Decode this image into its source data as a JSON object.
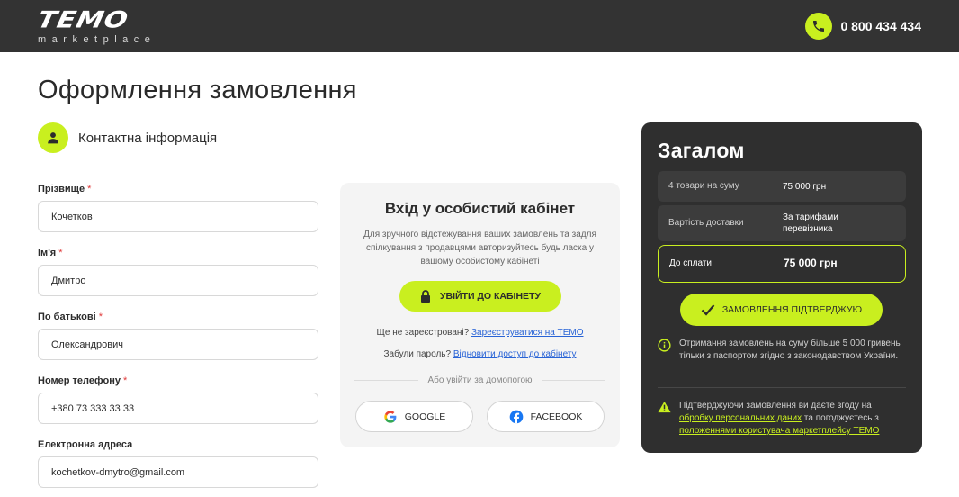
{
  "header": {
    "logo_main": "TEMO",
    "logo_sub": "marketplace",
    "phone": "0 800 434 434"
  },
  "page_title": "Оформлення замовлення",
  "contact": {
    "section_title": "Контактна інформація",
    "fields": [
      {
        "label": "Прізвище",
        "required": "*",
        "value": "Кочетков"
      },
      {
        "label": "Ім'я",
        "required": "*",
        "value": "Дмитро"
      },
      {
        "label": "По батькові",
        "required": "*",
        "value": "Олександрович"
      },
      {
        "label": "Номер телефону",
        "required": "*",
        "value": "+380 73 333 33 33"
      },
      {
        "label": "Електронна адреса",
        "required": "",
        "value": "kochetkov-dmytro@gmail.com"
      }
    ]
  },
  "login": {
    "title": "Вхід у особистий кабінет",
    "description": "Для зручного відстежування ваших замовлень та задля спілкування з продавцями авторизуйтесь будь ласка у вашому особистому кабінеті",
    "button_label": "УВІЙТИ ДО КАБІНЕТУ",
    "register_prefix": "Ще не зареєстровані?",
    "register_link": "Зареєструватися на ТЕМО",
    "forgot_prefix": "Забули пароль?",
    "forgot_link": "Відновити доступ до кабінету",
    "or_text": "Або увійти за домопогою",
    "google_label": "GOOGLE",
    "facebook_label": "FACEBOOK"
  },
  "summary": {
    "title": "Загалом",
    "items_label": "4 товари на суму",
    "items_value": "75 000 грн",
    "delivery_label": "Вартість доставки",
    "delivery_value": "За тарифами перевізника",
    "total_label": "До сплати",
    "total_value": "75 000 грн",
    "confirm_label": "ЗАМОВЛЕННЯ ПІДТВЕРДЖУЮ",
    "info_note": "Отримання замовлень на суму більше 5 000 гривень тільки з паспортом згідно з законодавством України.",
    "agree_prefix": "Підтверджуючи замовлення ви даєте згоду на",
    "agree_link1": "обробку персональних даних",
    "agree_middle": "та погоджуєтесь з",
    "agree_link2": "положеннями користувача маркетплейсу ТЕМО"
  },
  "colors": {
    "accent": "#c9ef1f",
    "dark": "#333333",
    "link": "#2863d6"
  }
}
